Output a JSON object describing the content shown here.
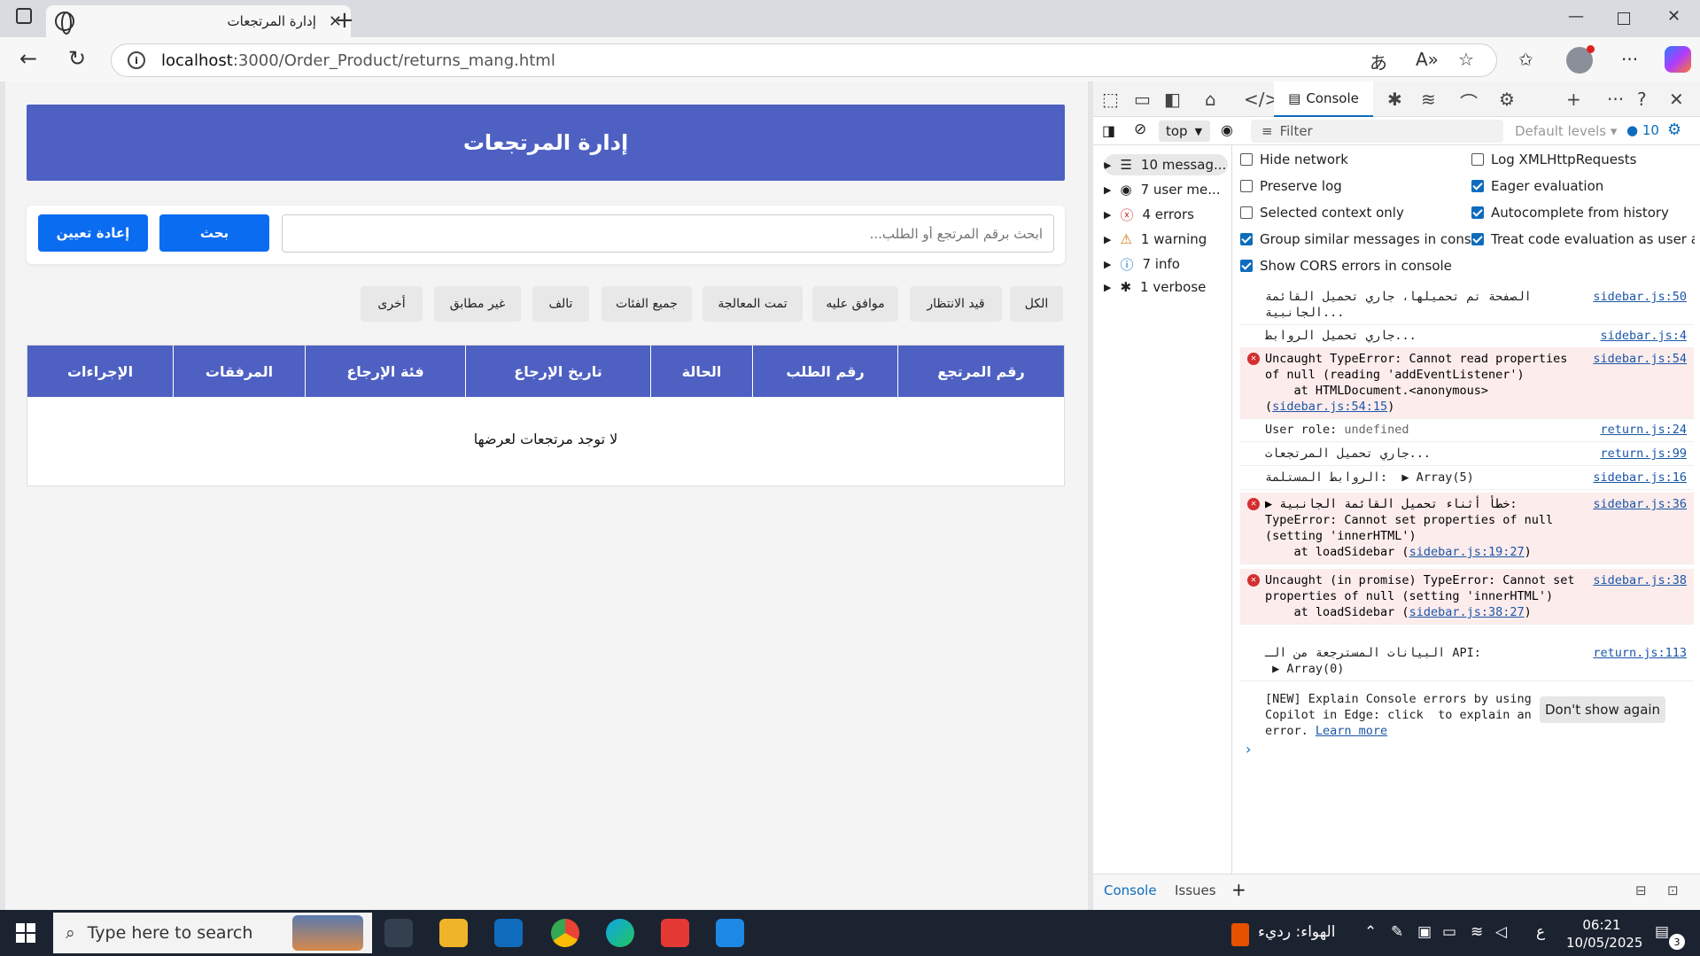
{
  "browser": {
    "tab_title": "إدارة المرتجعات",
    "url_host": "localhost",
    "url_path": ":3000/Order_Product/returns_mang.html"
  },
  "page": {
    "banner_title": "إدارة المرتجعات",
    "search_placeholder": "ابحث برقم المرتجع أو الطلب...",
    "search_button": "بحث",
    "reset_button": "إعادة تعيين",
    "filters": [
      "الكل",
      "قيد الانتظار",
      "موافق عليه",
      "تمت المعالجة",
      "جميع الفئات",
      "تالف",
      "غير مطابق",
      "أخرى"
    ],
    "table_headers": [
      "رقم المرتجع",
      "رقم الطلب",
      "الحالة",
      "تاريخ الإرجاع",
      "فئة الإرجاع",
      "المرفقات",
      "الإجراءات"
    ],
    "empty_message": "لا توجد مرتجعات لعرضها"
  },
  "devtools": {
    "console_tab": "Console",
    "context": "top",
    "filter_placeholder": "Filter",
    "levels": "Default levels",
    "issues_count": "10",
    "sidebar": [
      "10 messag...",
      "7 user me...",
      "4 errors",
      "1 warning",
      "7 info",
      "1 verbose"
    ],
    "settings_left": [
      "Hide network",
      "Preserve log",
      "Selected context only",
      "Group similar messages in console",
      "Show CORS errors in console"
    ],
    "settings_right": [
      "Log XMLHttpRequests",
      "Eager evaluation",
      "Autocomplete from history",
      "Treat code evaluation as user acti..."
    ],
    "logs": [
      {
        "text": "الصفحة تم تحميلها، جاري تحميل القائمة الجانبية...",
        "src": "sidebar.js:50"
      },
      {
        "text": "جاري تحميل الروابط...",
        "src": "sidebar.js:4"
      },
      {
        "text": "Uncaught TypeError: Cannot read properties of null (reading 'addEventListener')\n    at HTMLDocument.<anonymous> (",
        "link": "sidebar.js:54:15",
        "tail": ")",
        "src": "sidebar.js:54"
      },
      {
        "text": "User role: ",
        "extra": "undefined",
        "src": "return.js:24"
      },
      {
        "text": "جاري تحميل المرتجعات...",
        "src": "return.js:99"
      },
      {
        "text": "الروابط المستلمة:  ▶ Array(5)",
        "src": "sidebar.js:16"
      },
      {
        "text": "▶ خطأ أثناء تحميل القائمة الجانبية: TypeError: Cannot set properties of null (setting 'innerHTML')\n    at loadSidebar (",
        "link": "sidebar.js:19:27",
        "tail": ")",
        "src": "sidebar.js:36"
      },
      {
        "text": "Uncaught (in promise) TypeError: Cannot set properties of null (setting 'innerHTML')\n    at loadSidebar (",
        "link": "sidebar.js:38:27",
        "tail": ")",
        "src": "sidebar.js:38"
      },
      {
        "text": "البيانات المسترجعة من الـ API:\n ▶ Array(0)",
        "src": "return.js:113"
      },
      {
        "text": "[NEW] Explain Console errors by using Copilot in Edge: click  to explain an error. ",
        "link": "Learn more"
      }
    ],
    "dont_show": "Don't show again",
    "bottom_tabs": [
      "Console",
      "Issues"
    ]
  },
  "taskbar": {
    "search_placeholder": "Type here to search",
    "weather": "الهواء: رديء",
    "lang": "ع",
    "time": "06:21",
    "date": "10/05/2025",
    "notifications": "3"
  }
}
